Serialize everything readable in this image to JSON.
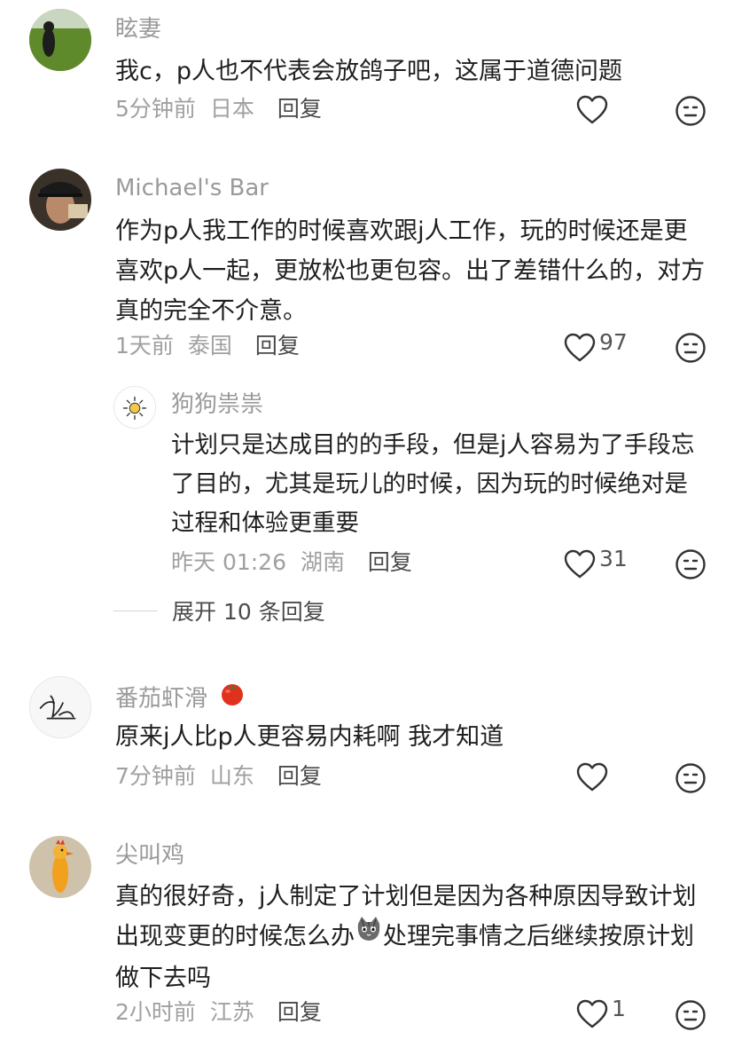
{
  "comments": [
    {
      "username": "眩妻",
      "text": "我c，p人也不代表会放鸽子吧，这属于道德问题",
      "time": "5分钟前",
      "location": "日本",
      "reply": "回复",
      "likes": ""
    },
    {
      "username": "Michael's Bar",
      "text": "作为p人我工作的时候喜欢跟j人工作，玩的时候还是更喜欢p人一起，更放松也更包容。出了差错什么的，对方真的完全不介意。",
      "time": "1天前",
      "location": "泰国",
      "reply": "回复",
      "likes": "97",
      "replies": [
        {
          "username": "狗狗祟祟",
          "text": "计划只是达成目的的手段，但是j人容易为了手段忘了目的，尤其是玩儿的时候，因为玩的时候绝对是过程和体验更重要",
          "time": "昨天 01:26",
          "location": "湖南",
          "reply": "回复",
          "likes": "31"
        }
      ],
      "expand_label": "展开 10 条回复"
    },
    {
      "username": "番茄虾滑",
      "username_emoji": "tomato-emoji",
      "text": "原来j人比p人更容易内耗啊 我才知道",
      "time": "7分钟前",
      "location": "山东",
      "reply": "回复",
      "likes": ""
    },
    {
      "username": "尖叫鸡",
      "text_before_emoji": "真的很好奇，j人制定了计划但是因为各种原因导致计划出现变更的时候怎么办",
      "inline_emoji": "cat-face-emoji",
      "text_after_emoji": "处理完事情之后继续按原计划做下去吗",
      "time": "2小时前",
      "location": "江苏",
      "reply": "回复",
      "likes": "1"
    }
  ],
  "icons": {
    "like": "heart-outline-icon",
    "dislike": "meh-face-icon"
  },
  "colors": {
    "username": "#9a9a9a",
    "meta": "#a0a0a0",
    "text": "#1f1f1f",
    "icon": "#333333"
  }
}
